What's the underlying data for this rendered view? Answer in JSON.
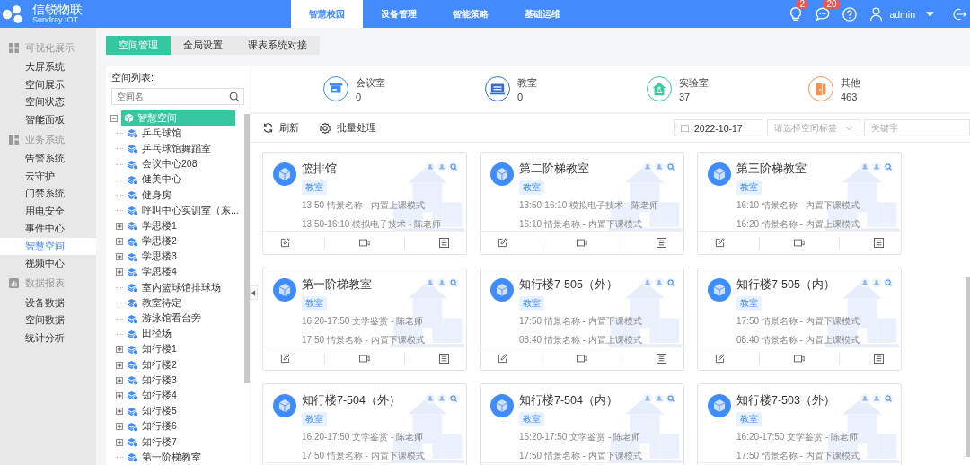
{
  "header": {
    "brand": "信锐物联",
    "brand_sub": "Sundray IOT",
    "nav": [
      {
        "label": "智慧校园",
        "selected": true
      },
      {
        "label": "设备管理",
        "selected": false
      },
      {
        "label": "智能策略",
        "selected": false
      },
      {
        "label": "基础运维",
        "selected": false
      }
    ],
    "tips_badge": "2",
    "messages_badge": "20",
    "user": "admin"
  },
  "sidebar": [
    {
      "title": "可视化展示",
      "items": [
        {
          "label": "大屏系统",
          "selected": false
        },
        {
          "label": "空间展示",
          "selected": false
        },
        {
          "label": "空间状态",
          "selected": false
        },
        {
          "label": "智能面板",
          "selected": false
        }
      ]
    },
    {
      "title": "业务系统",
      "items": [
        {
          "label": "告警系统",
          "selected": false
        },
        {
          "label": "云守护",
          "selected": false
        },
        {
          "label": "门禁系统",
          "selected": false
        },
        {
          "label": "用电安全",
          "selected": false
        },
        {
          "label": "事件中心",
          "selected": false
        },
        {
          "label": "智慧空间",
          "selected": true
        },
        {
          "label": "视频中心",
          "selected": false
        }
      ]
    },
    {
      "title": "数据报表",
      "items": [
        {
          "label": "设备数据",
          "selected": false
        },
        {
          "label": "空间数据",
          "selected": false
        },
        {
          "label": "统计分析",
          "selected": false
        }
      ]
    }
  ],
  "tabs": [
    {
      "label": "空间管理",
      "selected": true
    },
    {
      "label": "全局设置",
      "selected": false
    },
    {
      "label": "课表系统对接",
      "selected": false
    }
  ],
  "tree": {
    "title": "空间列表:",
    "search_placeholder": "空间名",
    "nodes": [
      {
        "label": "智慧空间",
        "kind": "root",
        "expanded": true,
        "selected": true,
        "children": [
          {
            "label": "乒乓球馆",
            "kind": "leaf",
            "selected": false
          },
          {
            "label": "乒乓球馆舞蹈室",
            "kind": "leaf",
            "selected": false
          },
          {
            "label": "会议中心208",
            "kind": "leaf",
            "selected": false
          },
          {
            "label": "健美中心",
            "kind": "leaf",
            "selected": false
          },
          {
            "label": "健身房",
            "kind": "leaf",
            "selected": false
          },
          {
            "label": "呼叫中心实训室（东...",
            "kind": "leaf",
            "selected": false
          },
          {
            "label": "学思楼1",
            "kind": "folder",
            "expanded": false,
            "selected": false
          },
          {
            "label": "学思楼2",
            "kind": "folder",
            "expanded": false,
            "selected": false
          },
          {
            "label": "学思楼3",
            "kind": "folder",
            "expanded": false,
            "selected": false
          },
          {
            "label": "学思楼4",
            "kind": "folder",
            "expanded": false,
            "selected": false
          },
          {
            "label": "室内篮球馆排球场",
            "kind": "leaf",
            "selected": false
          },
          {
            "label": "教室待定",
            "kind": "leaf",
            "selected": false
          },
          {
            "label": "游泳馆看台旁",
            "kind": "leaf",
            "selected": false
          },
          {
            "label": "田径场",
            "kind": "leaf",
            "selected": false
          },
          {
            "label": "知行楼1",
            "kind": "folder",
            "expanded": false,
            "selected": false
          },
          {
            "label": "知行楼2",
            "kind": "folder",
            "expanded": false,
            "selected": false
          },
          {
            "label": "知行楼3",
            "kind": "folder",
            "expanded": false,
            "selected": false
          },
          {
            "label": "知行楼4",
            "kind": "folder",
            "expanded": false,
            "selected": false
          },
          {
            "label": "知行楼5",
            "kind": "folder",
            "expanded": false,
            "selected": false
          },
          {
            "label": "知行楼6",
            "kind": "folder",
            "expanded": false,
            "selected": false
          },
          {
            "label": "知行楼7",
            "kind": "folder",
            "expanded": false,
            "selected": false
          },
          {
            "label": "第一阶梯教室",
            "kind": "leaf",
            "selected": false
          }
        ]
      }
    ]
  },
  "stats": [
    {
      "kind": "meeting",
      "label": "会议室",
      "count": "0",
      "color": "#3f8cff"
    },
    {
      "kind": "classroom",
      "label": "教室",
      "count": "0",
      "color": "#2f6fd6"
    },
    {
      "kind": "lab",
      "label": "实验室",
      "count": "37",
      "color": "#36c9a0"
    },
    {
      "kind": "other",
      "label": "其他",
      "count": "463",
      "color": "#f7924a"
    }
  ],
  "toolbar": [
    {
      "kind": "refresh",
      "label": "刷新"
    },
    {
      "kind": "batch",
      "label": "批量处理"
    }
  ],
  "filters": {
    "date": "2022-10-17",
    "tag_placeholder": "请选择空间标签",
    "keyword_placeholder": "关键字"
  },
  "cards": [
    {
      "name": "篮排馆",
      "tag": "教室",
      "lines": [
        "13:50 情景名称 - 内置上课模式",
        "13:50-16:10 模拟电子技术 - 陈老师"
      ]
    },
    {
      "name": "第二阶梯教室",
      "tag": "教室",
      "lines": [
        "13:50-16:10 模拟电子技术 - 陈老师",
        "16:10 情景名称 - 内置下课模式"
      ]
    },
    {
      "name": "第三阶梯教室",
      "tag": "教室",
      "lines": [
        "16:10 情景名称 - 内置下课模式",
        "16:20 情景名称 - 内置上课模式"
      ]
    },
    {
      "name": "第一阶梯教室",
      "tag": "教室",
      "lines": [
        "16:20-17:50 文学鉴赏 - 陈老师",
        "17:50 情景名称 - 内置下课模式"
      ]
    },
    {
      "name": "知行楼7-505（外）",
      "tag": "教室",
      "lines": [
        "17:50 情景名称 - 内置下课模式",
        "08:40 情景名称 - 内置上课模式"
      ]
    },
    {
      "name": "知行楼7-505（内）",
      "tag": "教室",
      "lines": [
        "17:50 情景名称 - 内置下课模式",
        "08:40 情景名称 - 内置上课模式"
      ]
    },
    {
      "name": "知行楼7-504（外）",
      "tag": "教室",
      "lines": [
        "16:20-17:50 文学鉴赏 - 陈老师",
        "17:50 情景名称 - 内置下课模式"
      ]
    },
    {
      "name": "知行楼7-504（内）",
      "tag": "教室",
      "lines": [
        "16:20-17:50 文学鉴赏 - 陈老师",
        "17:50 情景名称 - 内置下课模式"
      ]
    },
    {
      "name": "知行楼7-503（外）",
      "tag": "教室",
      "lines": [
        "16:20-17:50 文学鉴赏 - 陈老师",
        "17:50 情景名称 - 内置下课模式"
      ]
    }
  ]
}
